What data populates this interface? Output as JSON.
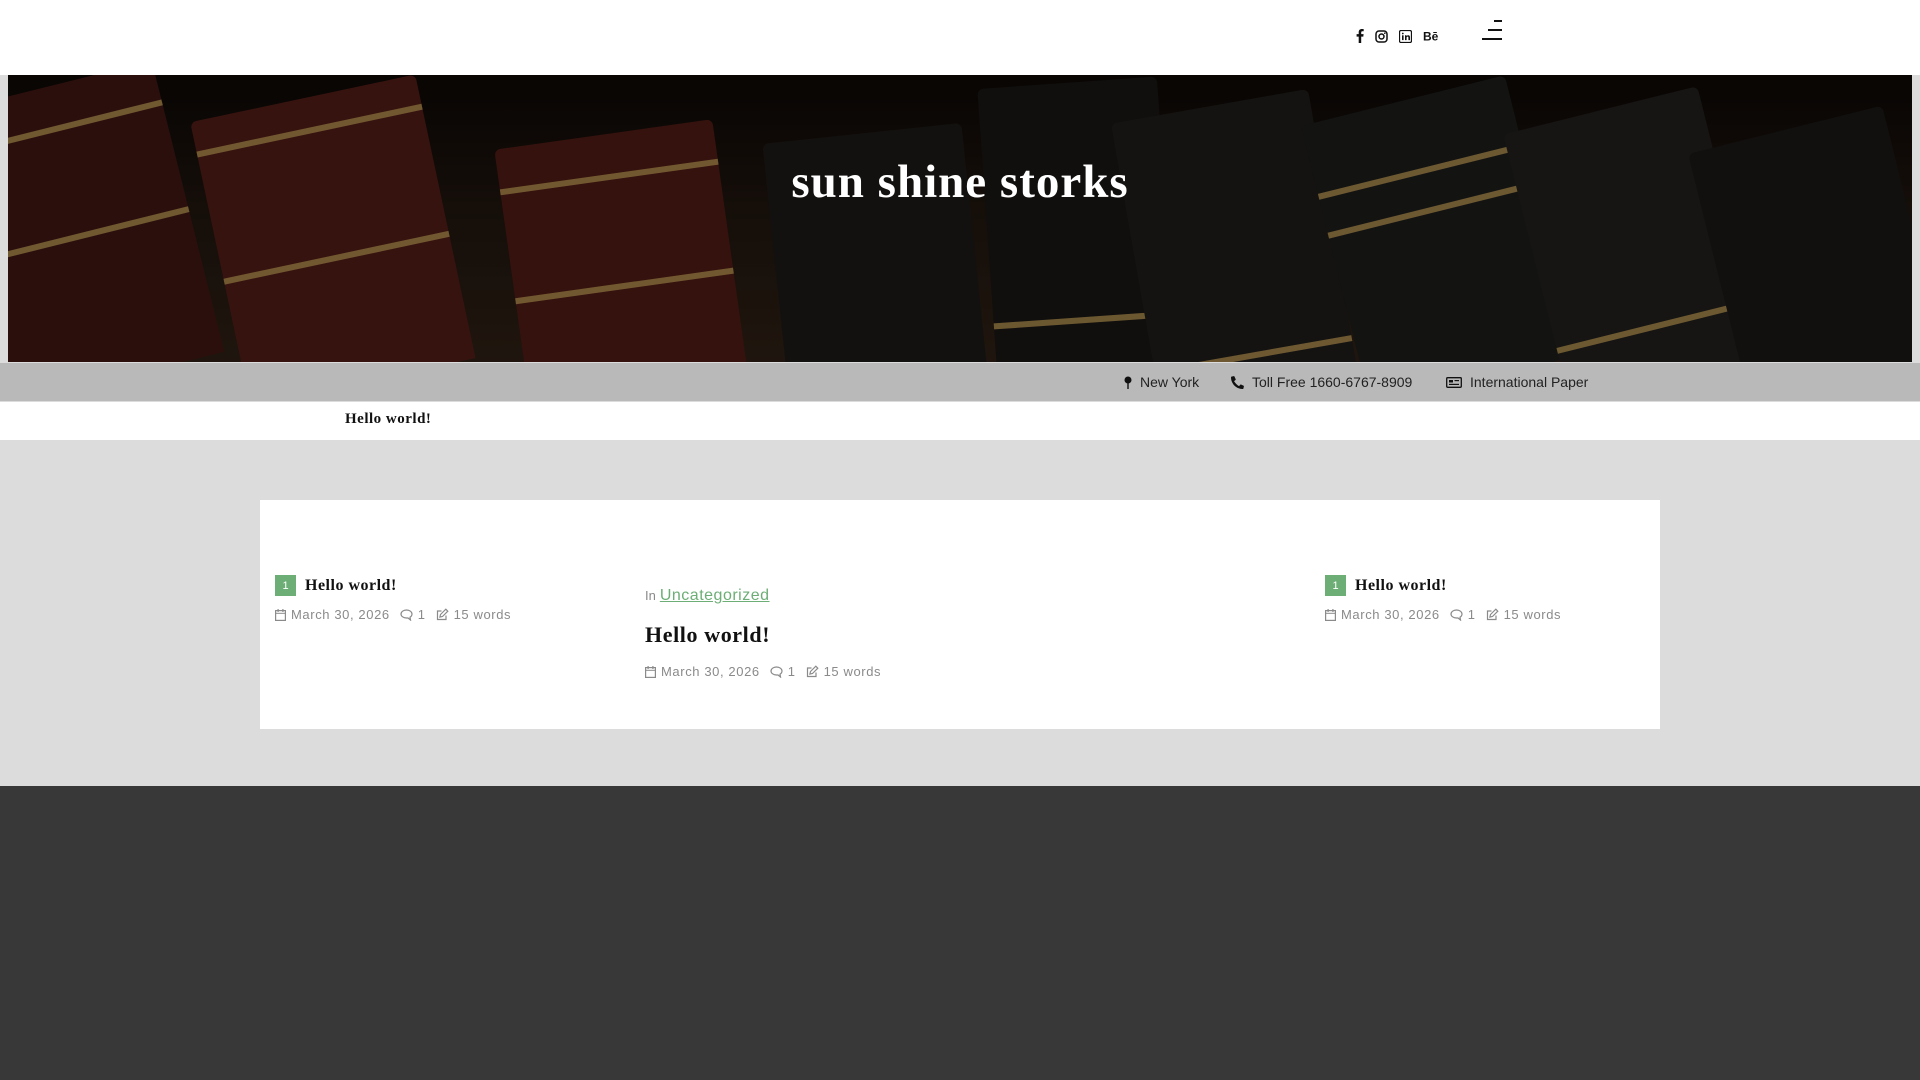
{
  "header": {
    "social": [
      {
        "icon": "facebook-icon",
        "glyph": "f"
      },
      {
        "icon": "instagram-icon",
        "glyph": ""
      },
      {
        "icon": "linkedin-icon",
        "glyph": ""
      },
      {
        "icon": "behance-icon",
        "glyph": "Bē"
      }
    ],
    "menu_icon": "menu-icon"
  },
  "hero": {
    "site_title": "sun shine storks"
  },
  "infobar": {
    "location": "New York",
    "phone": "Toll Free 1660-6767-8909",
    "paper": "International Paper"
  },
  "nav": {
    "item": "Hello world!"
  },
  "posts": {
    "left": {
      "rank": "1",
      "title": "Hello world!",
      "date": "March 30, 2026",
      "comments": "1",
      "words": "15 words"
    },
    "featured": {
      "in_label": "In",
      "category": "Uncategorized",
      "title": "Hello world!",
      "date": "March 30, 2026",
      "comments": "1",
      "words": "15 words"
    },
    "right": {
      "rank": "1",
      "title": "Hello world!",
      "date": "March 30, 2026",
      "comments": "1",
      "words": "15 words"
    }
  },
  "colors": {
    "accent": "#6cae75",
    "infobar": "#b9b9b9",
    "footer": "#383838",
    "page_bg": "#dcdcdc"
  }
}
